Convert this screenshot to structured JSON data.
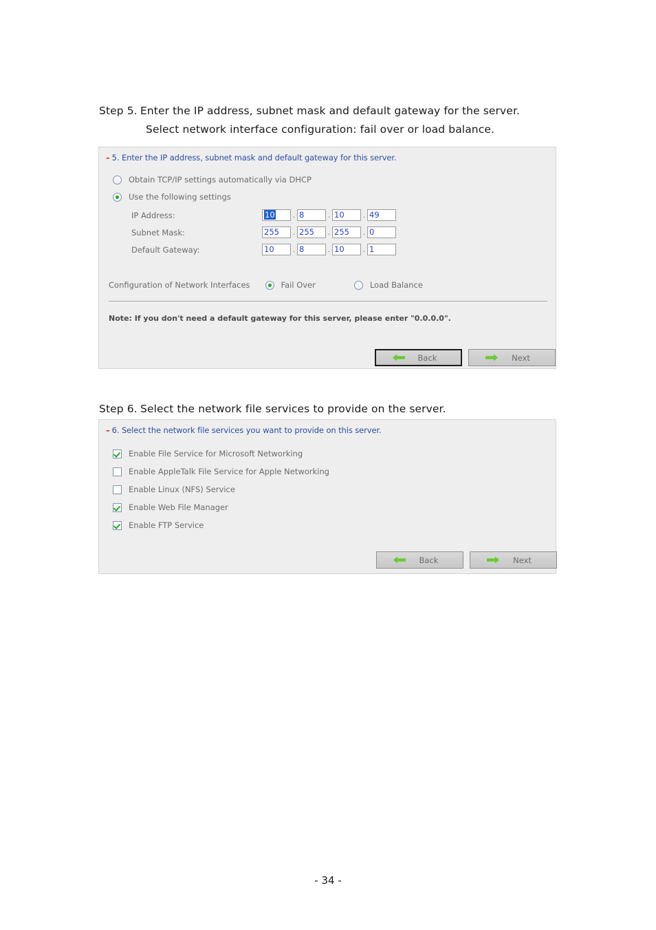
{
  "page": {
    "number_label": "- 34 -"
  },
  "step5": {
    "heading_line1_label": "Step 5.",
    "heading_line1_text": "Enter the IP address, subnet mask and default gateway for the server.",
    "heading_line2_text": "Select network interface configuration: fail over or load balance.",
    "panel": {
      "collapse_marker": "–",
      "header": "5. Enter the IP address, subnet mask and default gateway for this server.",
      "radios": [
        {
          "label": "Obtain TCP/IP settings automatically via DHCP",
          "checked": false
        },
        {
          "label": "Use the following settings",
          "checked": true
        }
      ],
      "fields": [
        {
          "label": "IP Address:",
          "octets": [
            "10",
            "8",
            "10",
            "49"
          ],
          "selected_octet": 0
        },
        {
          "label": "Subnet Mask:",
          "octets": [
            "255",
            "255",
            "255",
            "0"
          ],
          "selected_octet": -1
        },
        {
          "label": "Default Gateway:",
          "octets": [
            "10",
            "8",
            "10",
            "1"
          ],
          "selected_octet": -1
        }
      ],
      "interfaces": {
        "label": "Configuration of Network Interfaces",
        "options": [
          {
            "label": "Fail Over",
            "checked": true
          },
          {
            "label": "Load Balance",
            "checked": false
          }
        ]
      },
      "note": "Note: If you don't need a default gateway for this server, please enter \"0.0.0.0\".",
      "buttons": {
        "back_label": "Back",
        "next_label": "Next",
        "back_focused": true
      }
    }
  },
  "step6": {
    "heading_label": "Step 6.",
    "heading_text": "Select the network file services to provide on the server.",
    "panel": {
      "collapse_marker": "–",
      "header": "6. Select the network file services you want to provide on this server.",
      "services": [
        {
          "label": "Enable File Service for Microsoft Networking",
          "checked": true
        },
        {
          "label": "Enable AppleTalk File Service for Apple Networking",
          "checked": false
        },
        {
          "label": "Enable Linux (NFS) Service",
          "checked": false
        },
        {
          "label": "Enable Web File Manager",
          "checked": true
        },
        {
          "label": "Enable FTP Service",
          "checked": true
        }
      ],
      "buttons": {
        "back_label": "Back",
        "next_label": "Next",
        "back_focused": false
      }
    }
  },
  "colors": {
    "panel_bg": "#eeeeee",
    "header_blue": "#2b4ea2",
    "collapse_red": "#cc2222",
    "value_blue": "#2244cc",
    "selection_blue": "#1c5fd0",
    "accent_green": "#22aa22",
    "label_gray": "#6b6b6b"
  }
}
